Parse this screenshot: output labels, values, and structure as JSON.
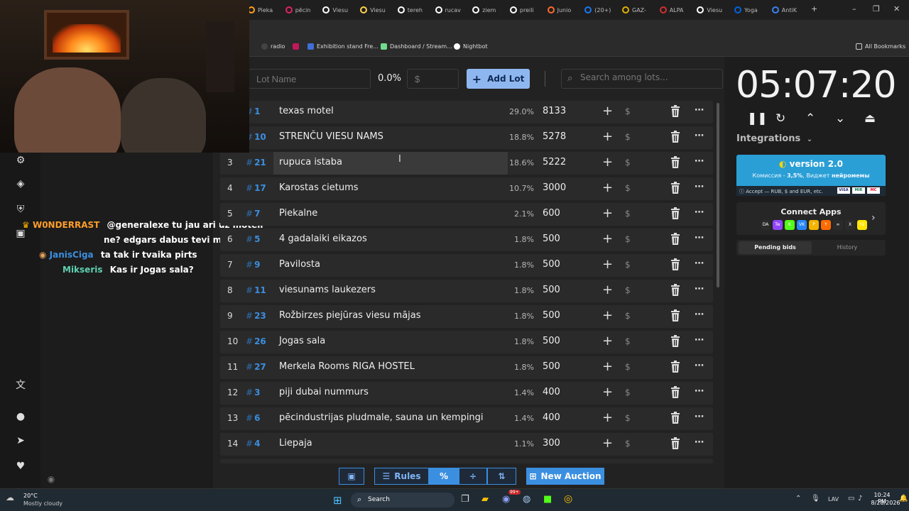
{
  "browser": {
    "tabs": [
      {
        "label": "Pieka",
        "color": "#ff9f1c"
      },
      {
        "label": "pēcin",
        "color": "#e0245e"
      },
      {
        "label": "Viesu",
        "color": "#ffffff"
      },
      {
        "label": "Viesu",
        "color": "#ffd34d"
      },
      {
        "label": "tereh",
        "color": "#ffffff"
      },
      {
        "label": "rucav",
        "color": "#ffffff"
      },
      {
        "label": "ziem",
        "color": "#ffffff"
      },
      {
        "label": "preili",
        "color": "#ffffff"
      },
      {
        "label": "Junio",
        "color": "#ff6a2b"
      },
      {
        "label": "(20+)",
        "color": "#1877f2"
      },
      {
        "label": "GAZ-",
        "color": "#e0b000"
      },
      {
        "label": "ALPA",
        "color": "#d32f2f"
      },
      {
        "label": "Viesu",
        "color": "#ffffff"
      },
      {
        "label": "Yoga",
        "color": "#0064e0"
      },
      {
        "label": "AntiK",
        "color": "#3b82f6"
      }
    ],
    "new_tab": "+",
    "window_controls": [
      "–",
      "❐",
      "✕"
    ],
    "bookmarks": [
      {
        "label": "radio",
        "color": "#cccccc"
      },
      {
        "label": "Exhibition stand Fre...",
        "color": "#3f6ed6"
      },
      {
        "label": "Dashboard / Stream...",
        "color": "#6fdc8c"
      },
      {
        "label": "Nightbot",
        "color": "#ffffff"
      }
    ],
    "all_bookmarks": "All Bookmarks"
  },
  "chat": {
    "messages": [
      {
        "user": "W0NDERRAST",
        "user_color": "#ff9d2a",
        "text": "@generalexe tu jau ari uz moteli"
      },
      {
        "user": "",
        "user_color": "#ff9d2a",
        "text": "ne? edgars dabus tevi majas laikaa"
      },
      {
        "user": "JanisCiga",
        "user_color": "#3b8fe0",
        "text": "ta tak ir tvaika pirts"
      },
      {
        "user": "Mikseris",
        "user_color": "#5fd0b0",
        "text": "Kas ir Jogas sala?"
      }
    ]
  },
  "controls": {
    "lot_name_placeholder": "Lot Name",
    "percent": "0.0%",
    "amount_placeholder": "$",
    "add_lot_label": "Add Lot",
    "search_placeholder": "Search among lots..."
  },
  "lots": [
    {
      "rank": "1",
      "id": "1",
      "name": "texas motel",
      "percent": "29.0%",
      "amount": "8133"
    },
    {
      "rank": "2",
      "id": "10",
      "name": "STRENČU VIESU NAMS",
      "percent": "18.8%",
      "amount": "5278"
    },
    {
      "rank": "3",
      "id": "21",
      "name": "rupuca istaba",
      "percent": "18.6%",
      "amount": "5222"
    },
    {
      "rank": "4",
      "id": "17",
      "name": "Karostas cietums",
      "percent": "10.7%",
      "amount": "3000"
    },
    {
      "rank": "5",
      "id": "7",
      "name": "Piekalne",
      "percent": "2.1%",
      "amount": "600"
    },
    {
      "rank": "6",
      "id": "5",
      "name": "4 gadalaiki eikazos",
      "percent": "1.8%",
      "amount": "500"
    },
    {
      "rank": "7",
      "id": "9",
      "name": "Pavilosta",
      "percent": "1.8%",
      "amount": "500"
    },
    {
      "rank": "8",
      "id": "11",
      "name": " viesunams laukezers",
      "percent": "1.8%",
      "amount": "500"
    },
    {
      "rank": "9",
      "id": "23",
      "name": "Rožbirzes piejūras viesu mājas",
      "percent": "1.8%",
      "amount": "500"
    },
    {
      "rank": "10",
      "id": "26",
      "name": "Jogas sala",
      "percent": "1.8%",
      "amount": "500"
    },
    {
      "rank": "11",
      "id": "27",
      "name": " Merkela Rooms RIGA HOSTEL",
      "percent": "1.8%",
      "amount": "500"
    },
    {
      "rank": "12",
      "id": "3",
      "name": "piji dubai nummurs",
      "percent": "1.4%",
      "amount": "400"
    },
    {
      "rank": "13",
      "id": "6",
      "name": "pēcindustrijas pludmale, sauna un kempingi",
      "percent": "1.4%",
      "amount": "400"
    },
    {
      "rank": "14",
      "id": "4",
      "name": "Liepaja",
      "percent": "1.1%",
      "amount": "300"
    }
  ],
  "bottom": {
    "rules_label": "Rules",
    "percent_icon": "%",
    "new_auction_label": "New Auction"
  },
  "timer": {
    "value": "05:07:20",
    "integrations_label": "Integrations"
  },
  "version_box": {
    "title": "version 2.0",
    "subtitle_prefix": "Комиссия - ",
    "commission": "3,5%",
    "subtitle_mid": ", Виджет ",
    "widget": "нейромемы",
    "accept": "Accept — RUB, $ and EUR, etc.",
    "cards": [
      "VISA",
      "MIR",
      "MC"
    ]
  },
  "connect_apps": {
    "title": "Connect Apps",
    "apps": [
      "DA",
      "Tw",
      "K",
      "VK",
      "P",
      "Y",
      "∞",
      "X",
      "Y2"
    ]
  },
  "bid_tabs": {
    "pending": "Pending bids",
    "history": "History"
  },
  "taskbar": {
    "weather_temp": "20°C",
    "weather_desc": "Mostly cloudy",
    "search_label": "Search",
    "lang": "LAV",
    "time": "10:24 PM",
    "date": "8/20/2026",
    "badge": "99+"
  }
}
